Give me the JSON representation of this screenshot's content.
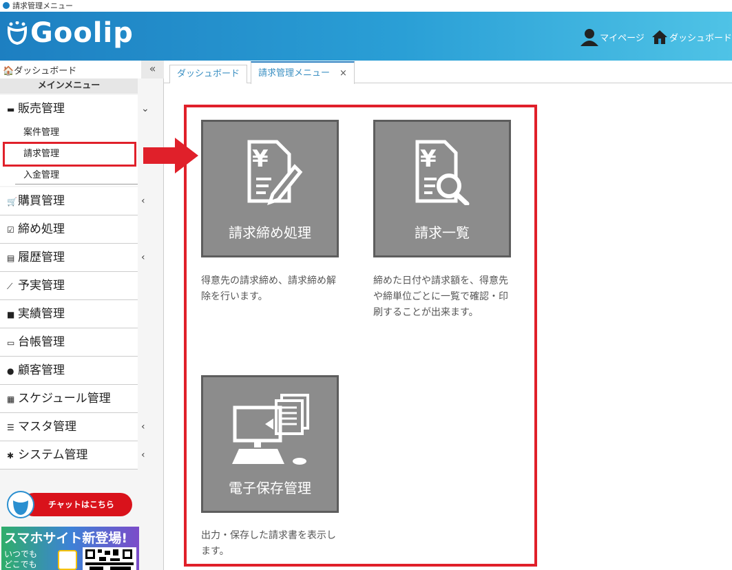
{
  "window": {
    "title": "請求管理メニュー"
  },
  "header": {
    "logo_text": "Goolip",
    "mypage": "マイページ",
    "dashboard": "ダッシュボード"
  },
  "sidebar": {
    "dashboard_link": "ダッシュボード",
    "collapse_glyph": "«",
    "main_menu": "メインメニュー",
    "items": [
      {
        "label": "販売管理",
        "icon": "register-icon",
        "caret": "⌄"
      },
      {
        "label": "購買管理",
        "icon": "cart-icon",
        "caret": "‹"
      },
      {
        "label": "締め処理",
        "icon": "checkbox-icon",
        "caret": ""
      },
      {
        "label": "履歴管理",
        "icon": "ledger-icon",
        "caret": "‹"
      },
      {
        "label": "予実管理",
        "icon": "linechart-icon",
        "caret": ""
      },
      {
        "label": "実績管理",
        "icon": "bookmark-icon",
        "caret": ""
      },
      {
        "label": "台帳管理",
        "icon": "book-icon",
        "caret": ""
      },
      {
        "label": "顧客管理",
        "icon": "users-icon",
        "caret": ""
      },
      {
        "label": "スケジュール管理",
        "icon": "calendar-icon",
        "caret": ""
      },
      {
        "label": "マスタ管理",
        "icon": "database-icon",
        "caret": "‹"
      },
      {
        "label": "システム管理",
        "icon": "gear-icon",
        "caret": "‹"
      }
    ],
    "sales_sub": [
      "案件管理",
      "請求管理",
      "入金管理"
    ],
    "chat_button": "チャットはこちら",
    "banner": {
      "title": "スマホサイト新登場!",
      "line1": "いつでも",
      "line2": "どこでも"
    }
  },
  "tabs": [
    {
      "label": "ダッシュボード"
    },
    {
      "label": "請求管理メニュー",
      "close": "×"
    }
  ],
  "cards": [
    {
      "label": "請求締め処理",
      "icon": "invoice-edit-icon",
      "desc": "得意先の請求締め、請求締め解除を行います。"
    },
    {
      "label": "請求一覧",
      "icon": "invoice-search-icon",
      "desc": "締めた日付や請求額を、得意先や締単位ごとに一覧で確認・印刷することが出来ます。"
    },
    {
      "label": "電子保存管理",
      "icon": "computer-document-icon",
      "desc": "出力・保存した請求書を表示します。"
    }
  ],
  "colors": {
    "accent": "#2a9fd6",
    "highlight": "#e0202a",
    "card": "#8c8c8c"
  }
}
